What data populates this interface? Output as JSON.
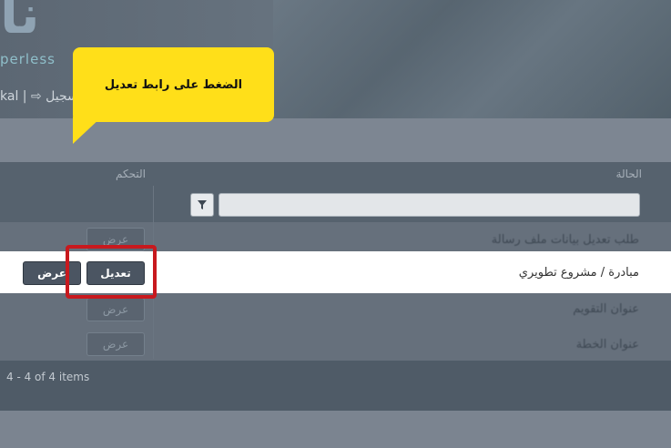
{
  "header": {
    "logo_text": "نا",
    "logo_sub": "perless",
    "user_links": "kal | ⇨ تسجيل"
  },
  "callout": {
    "text": "الضغط على رابط تعديل"
  },
  "table": {
    "col_status": "الحالة",
    "col_control": "التحكم",
    "rows": [
      {
        "status": "طلب تعديل بيانات ملف رسالة",
        "view": "عرض"
      },
      {
        "status": "مبادرة / مشروع تطويري",
        "edit": "تعديل",
        "view": "عرض"
      },
      {
        "status": "عنوان التقويم",
        "view": "عرض"
      },
      {
        "status": "عنوان الخطة",
        "view": "عرض"
      }
    ],
    "pager_text": "4 - 4 of 4 items"
  }
}
